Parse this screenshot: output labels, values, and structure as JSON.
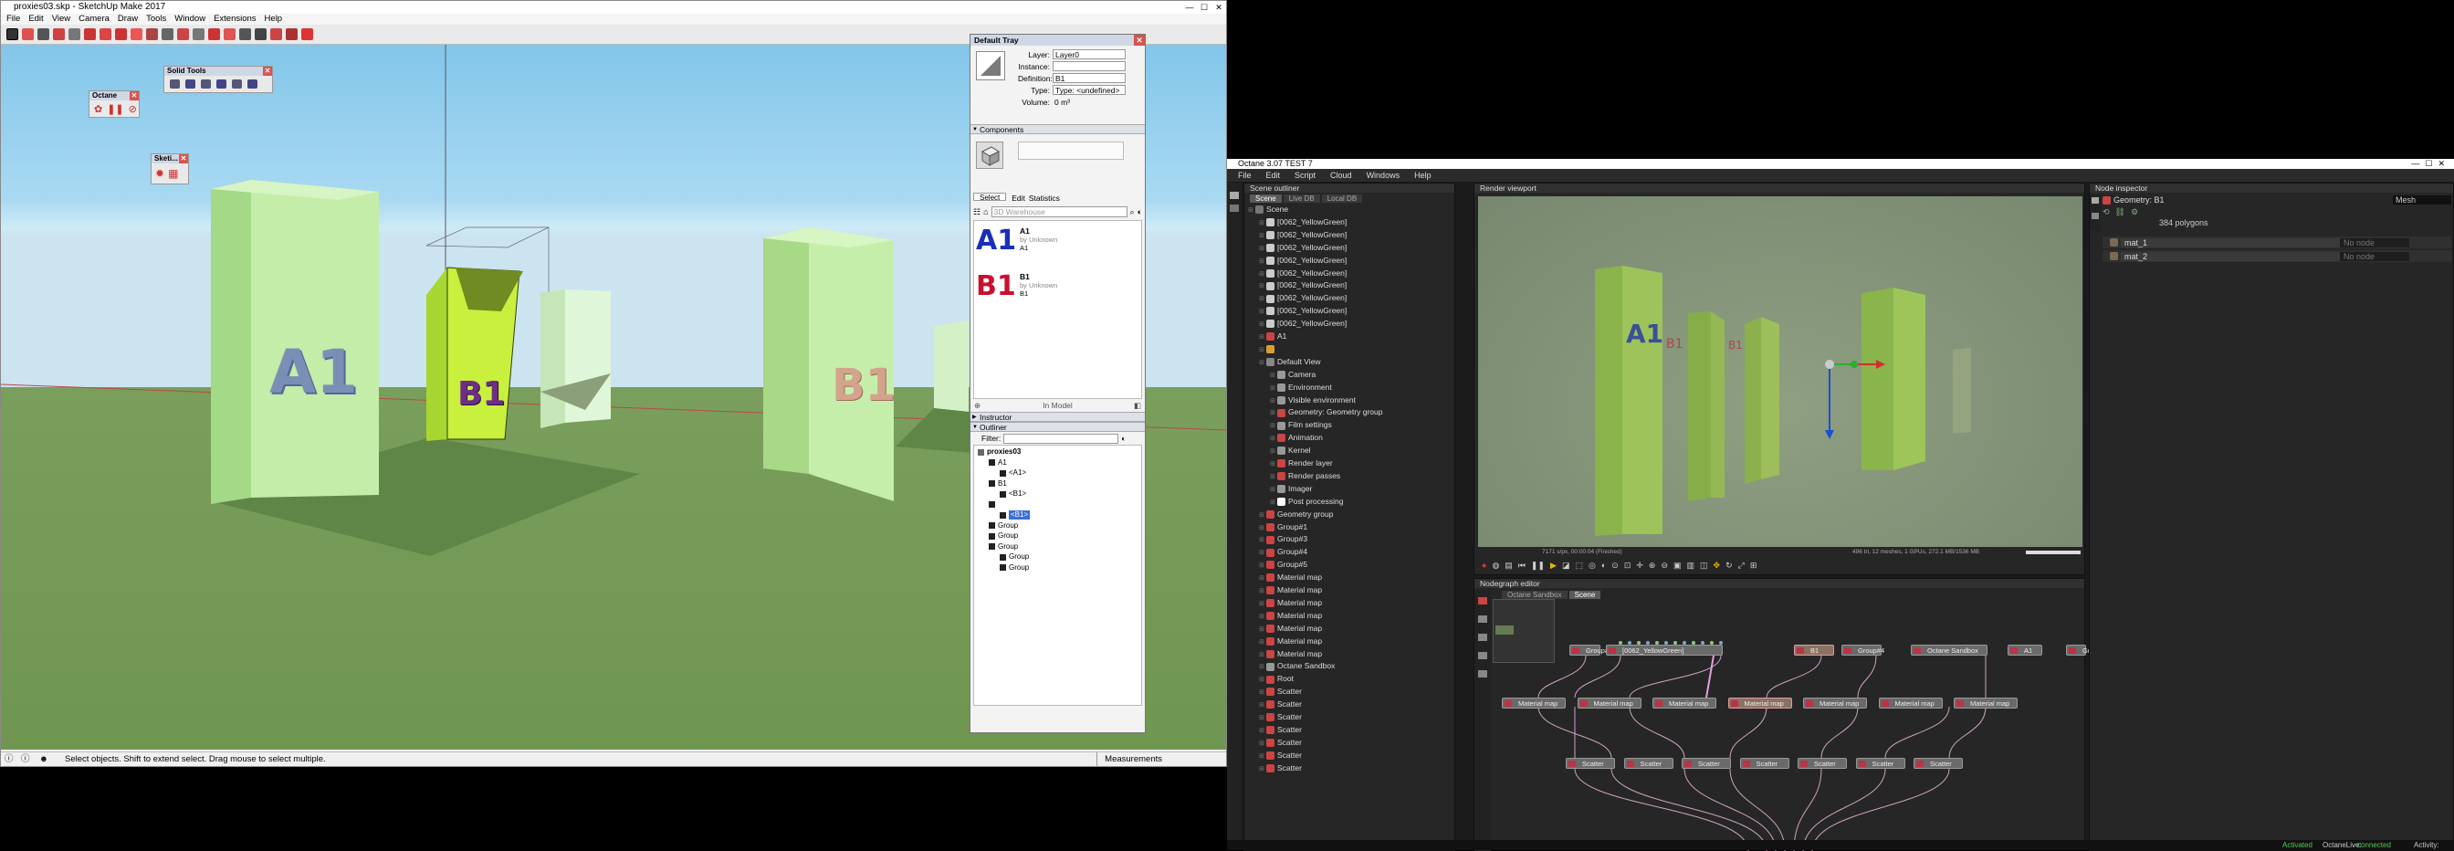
{
  "sketchup": {
    "title": "proxies03.skp - SketchUp Make 2017",
    "menu": [
      "File",
      "Edit",
      "View",
      "Camera",
      "Draw",
      "Tools",
      "Window",
      "Extensions",
      "Help"
    ],
    "toolbar_octane_title": "Octane",
    "toolbar_solid_title": "Solid Tools",
    "toolbar_sketch_title": "Sketi...",
    "labels_in_scene": {
      "a1": "A1",
      "b1_selected": "B1",
      "b1_right": "B1"
    },
    "status_text": "Select objects. Shift to extend select. Drag mouse to select multiple.",
    "measurements_label": "Measurements",
    "tray": {
      "title": "Default Tray",
      "entity": {
        "layer_label": "Layer:",
        "layer_value": "Layer0",
        "instance_label": "Instance:",
        "instance_value": "",
        "definition_label": "Definition:",
        "definition_value": "B1",
        "type_label": "Type:",
        "type_value": "Type: <undefined>",
        "volume_label": "Volume:",
        "volume_value": "0 m³"
      },
      "components_section": "Components",
      "tabs": [
        "Select",
        "Edit",
        "Statistics"
      ],
      "search_placeholder": "3D Warehouse",
      "components": [
        {
          "glyph": "A1",
          "name": "A1",
          "by": "by",
          "author": "Unknown",
          "sub": "A1",
          "color": "#1a2fb8"
        },
        {
          "glyph": "B1",
          "name": "B1",
          "by": "by",
          "author": "Unknown",
          "sub": "B1",
          "color": "#c8102e"
        }
      ],
      "in_model": "In Model",
      "instructor_section": "Instructor",
      "outliner_section": "Outliner",
      "filter_label": "Filter:",
      "outliner": [
        {
          "text": "proxies03",
          "level": 0,
          "bold": true
        },
        {
          "text": "A1",
          "level": 1
        },
        {
          "text": "<A1>",
          "level": 2
        },
        {
          "text": "B1",
          "level": 1
        },
        {
          "text": "<B1>",
          "level": 2
        },
        {
          "text": "",
          "level": 1
        },
        {
          "text": "<B1>",
          "level": 2,
          "selected": true
        },
        {
          "text": "Group",
          "level": 1
        },
        {
          "text": "Group",
          "level": 1
        },
        {
          "text": "Group",
          "level": 1
        },
        {
          "text": "Group",
          "level": 2
        },
        {
          "text": "Group",
          "level": 2
        }
      ]
    }
  },
  "octane": {
    "title": "Octane 3.07 TEST 7",
    "menu": [
      "File",
      "Edit",
      "Script",
      "Cloud",
      "Windows",
      "Help"
    ],
    "outliner": {
      "title": "Scene outliner",
      "tabs": [
        "Scene",
        "Live DB",
        "Local DB"
      ],
      "rows": [
        {
          "t": "Scene",
          "lvl": 0,
          "c": "#777"
        },
        {
          "t": "[0062_YellowGreen]",
          "lvl": 1,
          "c": "#ccc"
        },
        {
          "t": "[0062_YellowGreen]",
          "lvl": 1,
          "c": "#ccc"
        },
        {
          "t": "[0062_YellowGreen]",
          "lvl": 1,
          "c": "#ccc"
        },
        {
          "t": "[0062_YellowGreen]",
          "lvl": 1,
          "c": "#ccc"
        },
        {
          "t": "[0062_YellowGreen]",
          "lvl": 1,
          "c": "#ccc"
        },
        {
          "t": "[0062_YellowGreen]",
          "lvl": 1,
          "c": "#ccc"
        },
        {
          "t": "[0062_YellowGreen]",
          "lvl": 1,
          "c": "#ccc"
        },
        {
          "t": "[0062_YellowGreen]",
          "lvl": 1,
          "c": "#ccc"
        },
        {
          "t": "[0062_YellowGreen]",
          "lvl": 1,
          "c": "#ccc"
        },
        {
          "t": "A1",
          "lvl": 1,
          "c": "#c44"
        },
        {
          "t": "",
          "lvl": 1,
          "c": "#d9a030"
        },
        {
          "t": "Default View",
          "lvl": 1,
          "c": "#888"
        },
        {
          "t": "Camera",
          "lvl": 2,
          "c": "#999"
        },
        {
          "t": "Environment",
          "lvl": 2,
          "c": "#999"
        },
        {
          "t": "Visible environment",
          "lvl": 2,
          "c": "#999"
        },
        {
          "t": "Geometry: Geometry group",
          "lvl": 2,
          "c": "#c44"
        },
        {
          "t": "Film settings",
          "lvl": 2,
          "c": "#999"
        },
        {
          "t": "Animation",
          "lvl": 2,
          "c": "#c44"
        },
        {
          "t": "Kernel",
          "lvl": 2,
          "c": "#999"
        },
        {
          "t": "Render layer",
          "lvl": 2,
          "c": "#c44"
        },
        {
          "t": "Render passes",
          "lvl": 2,
          "c": "#c44"
        },
        {
          "t": "Imager",
          "lvl": 2,
          "c": "#999"
        },
        {
          "t": "Post processing",
          "lvl": 2,
          "c": "#fff"
        },
        {
          "t": "Geometry group",
          "lvl": 1,
          "c": "#c44"
        },
        {
          "t": "Group#1",
          "lvl": 1,
          "c": "#c44"
        },
        {
          "t": "Group#3",
          "lvl": 1,
          "c": "#c44"
        },
        {
          "t": "Group#4",
          "lvl": 1,
          "c": "#c44"
        },
        {
          "t": "Group#5",
          "lvl": 1,
          "c": "#c44"
        },
        {
          "t": "Material map",
          "lvl": 1,
          "c": "#c44"
        },
        {
          "t": "Material map",
          "lvl": 1,
          "c": "#c44"
        },
        {
          "t": "Material map",
          "lvl": 1,
          "c": "#c44"
        },
        {
          "t": "Material map",
          "lvl": 1,
          "c": "#c44"
        },
        {
          "t": "Material map",
          "lvl": 1,
          "c": "#c44"
        },
        {
          "t": "Material map",
          "lvl": 1,
          "c": "#c44"
        },
        {
          "t": "Material map",
          "lvl": 1,
          "c": "#c44"
        },
        {
          "t": "Octane Sandbox",
          "lvl": 1,
          "c": "#999"
        },
        {
          "t": "Root",
          "lvl": 1,
          "c": "#c44"
        },
        {
          "t": "Scatter",
          "lvl": 1,
          "c": "#c44"
        },
        {
          "t": "Scatter",
          "lvl": 1,
          "c": "#c44"
        },
        {
          "t": "Scatter",
          "lvl": 1,
          "c": "#c44"
        },
        {
          "t": "Scatter",
          "lvl": 1,
          "c": "#c44"
        },
        {
          "t": "Scatter",
          "lvl": 1,
          "c": "#c44"
        },
        {
          "t": "Scatter",
          "lvl": 1,
          "c": "#c44"
        },
        {
          "t": "Scatter",
          "lvl": 1,
          "c": "#c44"
        }
      ]
    },
    "viewport": {
      "title": "Render viewport",
      "stats_left": "7171 s/px, 00:00:04 (Finished)",
      "stats_right": "496 tri, 12 meshes, 1 GPUs, 272.1 MB/1536 MB",
      "labels": [
        "A1",
        "B1",
        "B1"
      ]
    },
    "nodegraph": {
      "title": "Nodegraph editor",
      "tabs": [
        "Octane Sandbox",
        "Scene"
      ],
      "top_nodes": [
        "Group#3",
        "[0062_YellowGreen]",
        "B1",
        "Group#4",
        "Octane Sandbox",
        "A1",
        "Gro"
      ],
      "material_maps": [
        "Material map",
        "Material map",
        "Material map",
        "Material map",
        "Material map",
        "Material map",
        "Material map"
      ],
      "scatters": [
        "Scatter",
        "Scatter",
        "Scatter",
        "Scatter",
        "Scatter",
        "Scatter",
        "Scatter"
      ]
    },
    "inspector": {
      "title": "Node inspector",
      "geometry_label": "Geometry: B1",
      "geometry_type": "Mesh",
      "polygons": "384 polygons",
      "materials": [
        {
          "name": "mat_1",
          "value": "No node"
        },
        {
          "name": "mat_2",
          "value": "No node"
        }
      ]
    },
    "status": {
      "activated": "Activated",
      "octanelive_label": "OctaneLive:",
      "octanelive_value": "connected",
      "activity_label": "Activity:"
    }
  }
}
